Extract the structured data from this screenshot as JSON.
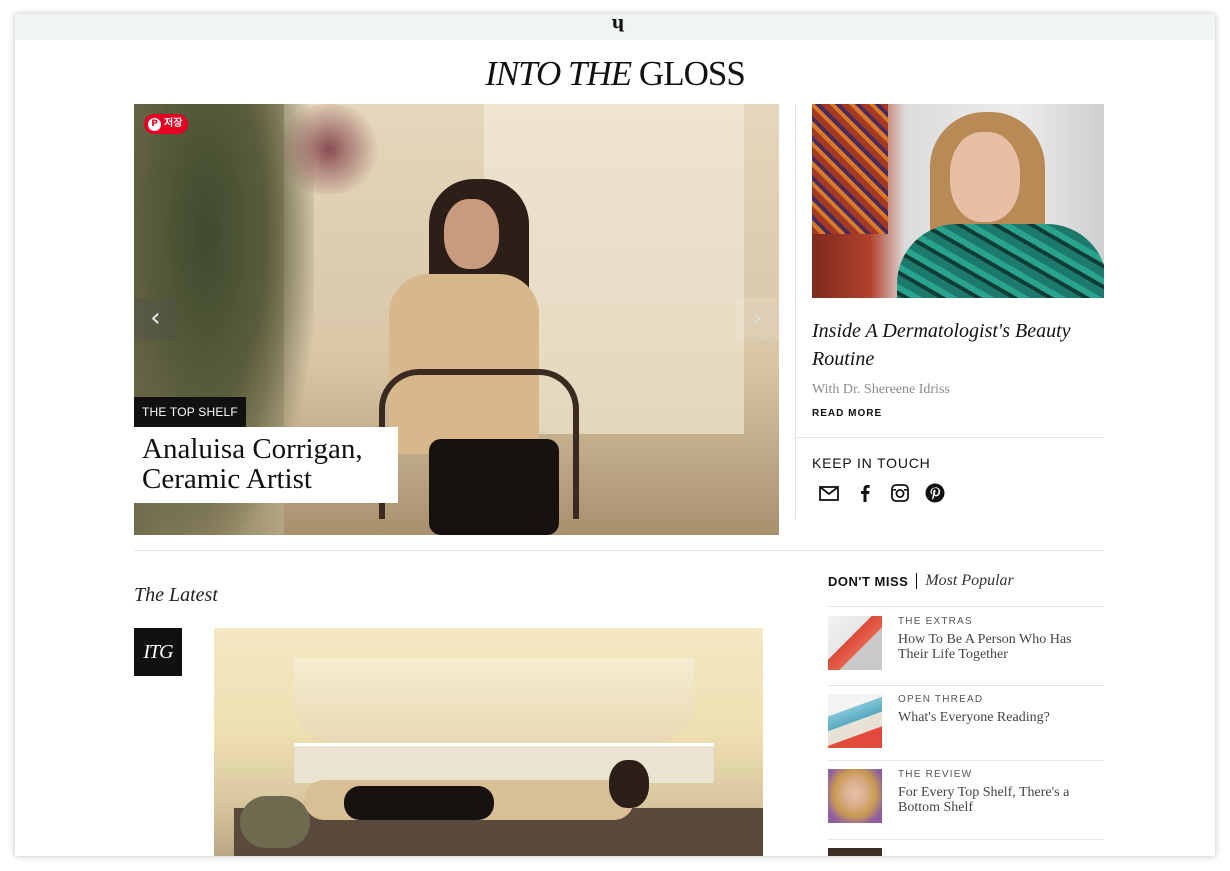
{
  "header": {
    "logo_italic": "INTO THE",
    "logo_plain": "GLOSS"
  },
  "hero": {
    "pin_label": "저장",
    "tag": "THE TOP SHELF",
    "title_line1": "Analuisa Corrigan,",
    "title_line2": "Ceramic Artist",
    "prev_arrow": "‹",
    "next_arrow": "›"
  },
  "feature": {
    "title": "Inside A Dermatologist's Beauty Routine",
    "subtitle": "With Dr. Shereene Idriss",
    "read_more": "READ MORE"
  },
  "keep_in_touch": {
    "title": "KEEP IN TOUCH",
    "icons": [
      "mail-icon",
      "facebook-icon",
      "instagram-icon",
      "pinterest-icon"
    ]
  },
  "latest": {
    "heading": "The Latest",
    "badge": "ITG"
  },
  "dont_miss": {
    "tab_active": "DON'T MISS",
    "tab_other": "Most Popular",
    "items": [
      {
        "category": "THE EXTRAS",
        "title": "How To Be A Person Who Has Their Life Together"
      },
      {
        "category": "OPEN THREAD",
        "title": "What's Everyone Reading?"
      },
      {
        "category": "THE REVIEW",
        "title": "For Every Top Shelf, There's a Bottom Shelf"
      }
    ]
  },
  "colors": {
    "topbar": "#f1f4f4",
    "pinterest_red": "#e60023",
    "text": "#111111"
  }
}
